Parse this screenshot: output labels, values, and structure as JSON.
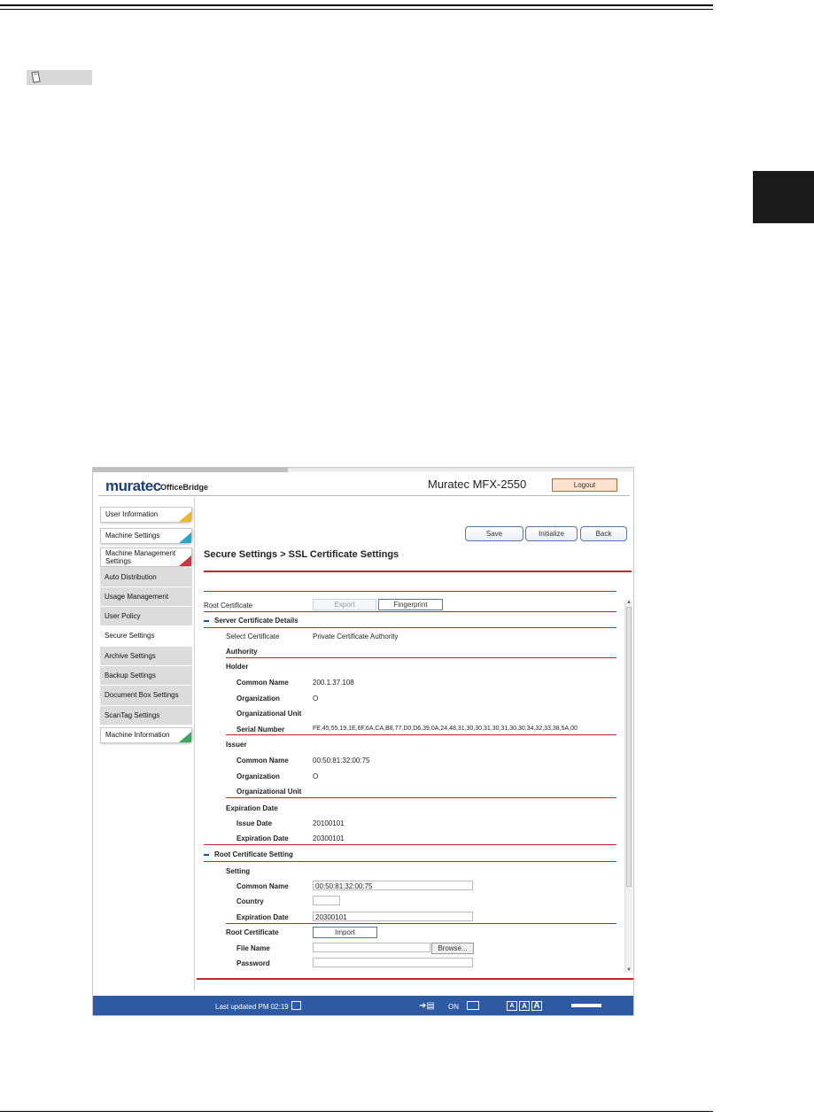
{
  "header_bar": {
    "logo": "muratec",
    "logo_sub": "OfficeBridge",
    "model": "Muratec MFX-2550",
    "logout_label": "Logout"
  },
  "sidebar": {
    "items": [
      {
        "label": "User Information",
        "color": "#e8b92a"
      },
      {
        "label": "Machine Settings",
        "color": "#2aa6c9"
      },
      {
        "label": "Machine Management Settings",
        "color": "#c9343f"
      },
      {
        "label": "Auto Distribution"
      },
      {
        "label": "Usage Management"
      },
      {
        "label": "User Policy"
      },
      {
        "label": "Secure Settings"
      },
      {
        "label": "Archive Settings"
      },
      {
        "label": "Backup Settings"
      },
      {
        "label": "Document Box Settings"
      },
      {
        "label": "ScanTag Settings"
      },
      {
        "label": "Machine Information",
        "color": "#3aa85a"
      }
    ]
  },
  "toolbar": {
    "save_label": "Save",
    "initialize_label": "Initialize",
    "back_label": "Back"
  },
  "page_title": "Secure Settings > SSL Certificate Settings",
  "content": {
    "root_certificate_label": "Root Certificate",
    "export_label": "Export",
    "fingerprint_label": "Fingerprint",
    "server_details_heading": "Server Certificate Details",
    "select_certificate_label": "Select Certificate",
    "select_certificate_value": "Private Certificate Authority",
    "authority_label": "Authority",
    "holder_label": "Holder",
    "holder_common_name_label": "Common Name",
    "holder_common_name_value": "200.1.37.108",
    "holder_organization_label": "Organization",
    "holder_organization_value": "O",
    "holder_org_unit_label": "Organizational Unit",
    "serial_number_label": "Serial Number",
    "serial_number_value": "FE,45,55,19,1E,6F,6A,CA,B8,77,D0,D6,39,0A,24,48,31,30,30,31,30,31,30,30,34,32,33,38,5A,00",
    "issuer_label": "Issuer",
    "issuer_common_name_label": "Common Name",
    "issuer_common_name_value": "00:50:81:32:00:75",
    "issuer_organization_label": "Organization",
    "issuer_organization_value": "O",
    "issuer_org_unit_label": "Organizational Unit",
    "expiration_heading": "Expiration Date",
    "issue_date_label": "Issue Date",
    "issue_date_value": "20100101",
    "expiration_date_label": "Expiration Date",
    "expiration_date_value": "20300101",
    "root_setting_heading": "Root Certificate Setting",
    "setting_label": "Setting",
    "setting_common_name_label": "Common Name",
    "setting_common_name_value": "00:50:81:32:00:75",
    "country_label": "Country",
    "country_value": "",
    "setting_expiration_label": "Expiration Date",
    "setting_expiration_value": "20300101",
    "root_cert_import_label": "Root Certificate",
    "import_label": "Import",
    "file_name_label": "File Name",
    "file_name_value": "",
    "browse_label": "Browse...",
    "password_label": "Password",
    "password_value": ""
  },
  "footer": {
    "last_updated": "Last updated PM 02:19",
    "on_label": "ON",
    "font_sizes": [
      "A",
      "A",
      "A"
    ]
  }
}
